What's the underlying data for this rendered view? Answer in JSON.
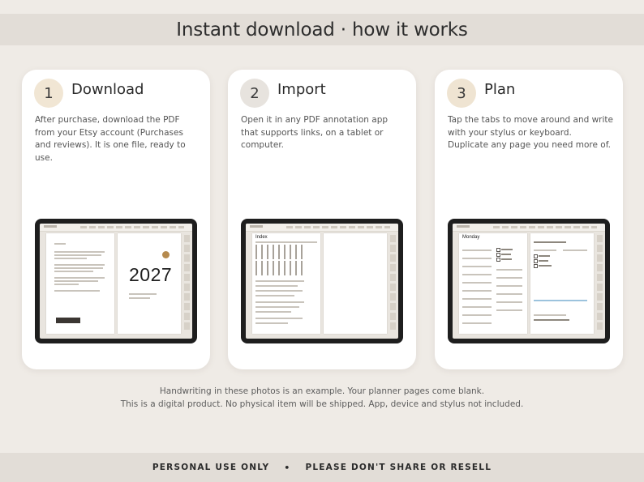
{
  "header": {
    "title": "Instant download · how it works"
  },
  "steps": [
    {
      "number": "1",
      "title": "Download",
      "description": "After purchase, download the PDF from your Etsy account (Purchases and reviews). It is one file, ready to use.",
      "badge_color": "#f1e6d4",
      "preview": {
        "cover_year": "2027"
      }
    },
    {
      "number": "2",
      "title": "Import",
      "description": "Open it in any PDF annotation app that supports links, on a tablet or computer.",
      "badge_color": "#e7e3de",
      "preview": {
        "page_title": "Index"
      }
    },
    {
      "number": "3",
      "title": "Plan",
      "description": "Tap the tabs to move around and write with your stylus or keyboard. Duplicate any page you need more of.",
      "badge_color": "#efe4d2",
      "preview": {
        "page_title": "Monday"
      }
    }
  ],
  "footnotes": {
    "line1": "Handwriting in these photos is an example. Your planner pages come blank.",
    "line2": "This is a digital product. No physical item will be shipped. App, device and stylus not included."
  },
  "footer": {
    "left": "PERSONAL USE ONLY",
    "separator": "•",
    "right": "PLEASE DON'T SHARE OR RESELL"
  },
  "colors": {
    "background": "#efebe6",
    "band": "#e2ddd7",
    "card": "#ffffff",
    "accent": "#b58a4e",
    "tablet": "#1e1e1e"
  }
}
